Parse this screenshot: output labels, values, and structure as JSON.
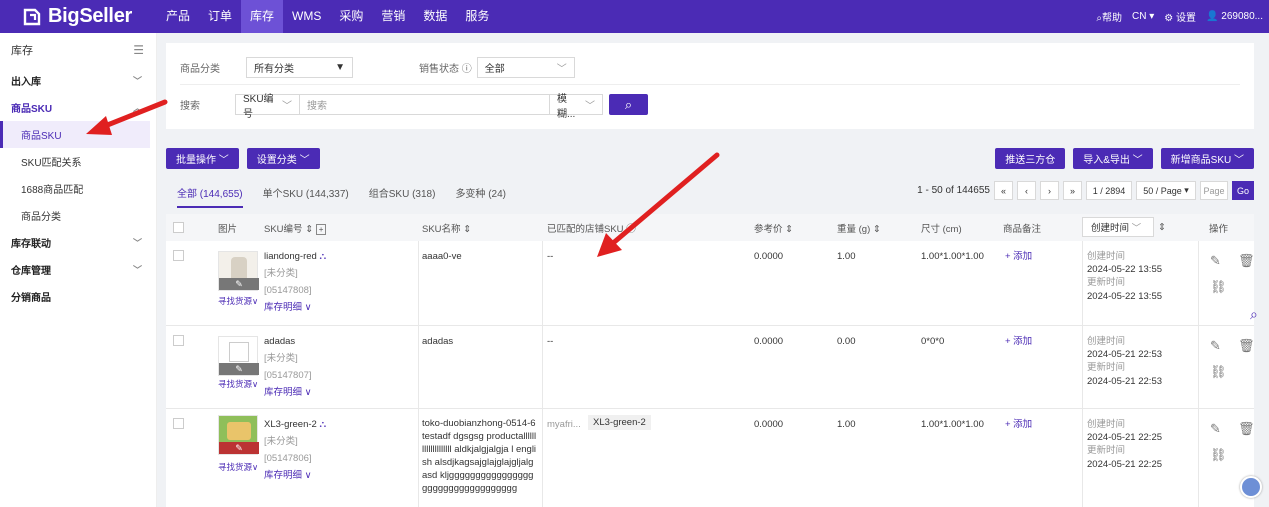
{
  "brand": {
    "name": "BigSeller"
  },
  "nav": {
    "items": [
      "产品",
      "订单",
      "库存",
      "WMS",
      "采购",
      "营销",
      "数据",
      "服务"
    ],
    "active": "库存"
  },
  "topright": {
    "help": "帮助",
    "lang": "CN",
    "settings": "设置",
    "user": "269080..."
  },
  "sidebar": {
    "title": "库存",
    "groups": [
      {
        "label": "出入库"
      },
      {
        "label": "商品SKU",
        "items": [
          "商品SKU",
          "SKU匹配关系",
          "1688商品匹配",
          "商品分类"
        ]
      },
      {
        "label": "库存联动"
      },
      {
        "label": "仓库管理"
      },
      {
        "label": "分销商品"
      }
    ]
  },
  "filter": {
    "category_label": "商品分类",
    "category_value": "所有分类",
    "status_label": "销售状态",
    "status_value": "全部",
    "search_label": "搜索",
    "search_field": "SKU编号",
    "search_placeholder": "搜索",
    "match_mode": "模糊..."
  },
  "toolbar": {
    "batch": "批量操作",
    "set_category": "设置分类",
    "push": "推送三方仓",
    "import_export": "导入&导出",
    "add": "新增商品SKU"
  },
  "tabs": [
    {
      "label": "全部 (144,655)"
    },
    {
      "label": "单个SKU (144,337)"
    },
    {
      "label": "组合SKU (318)"
    },
    {
      "label": "多变种 (24)"
    }
  ],
  "pager": {
    "range": "1 - 50 of 144655",
    "page": "1 / 2894",
    "per_page": "50 / Page",
    "page_placeholder": "Page",
    "go": "Go"
  },
  "columns": {
    "image": "图片",
    "sku_code": "SKU编号",
    "sku_name": "SKU名称",
    "matched": "已匹配的店铺SKU",
    "price": "参考价",
    "weight": "重量 (g)",
    "size": "尺寸 (cm)",
    "note": "商品备注",
    "time": "创建时间",
    "ops": "操作"
  },
  "rows": [
    {
      "sku": "liandong-red",
      "category": "[未分类]",
      "id": "[05147808]",
      "source": "寻找货源",
      "stock": "库存明细",
      "name": "aaaa0-ve",
      "matched": "--",
      "store": "",
      "price": "0.0000",
      "weight": "1.00",
      "size": "1.00*1.00*1.00",
      "note": "+ 添加",
      "created_label": "创建时间",
      "created": "2024-05-22 13:55",
      "updated_label": "更新时间",
      "updated": "2024-05-22 13:55"
    },
    {
      "sku": "adadas",
      "category": "[未分类]",
      "id": "[05147807]",
      "source": "寻找货源",
      "stock": "库存明细",
      "name": "adadas",
      "matched": "--",
      "store": "",
      "price": "0.0000",
      "weight": "0.00",
      "size": "0*0*0",
      "note": "+ 添加",
      "created_label": "创建时间",
      "created": "2024-05-21 22:53",
      "updated_label": "更新时间",
      "updated": "2024-05-21 22:53"
    },
    {
      "sku": "XL3-green-2",
      "category": "[未分类]",
      "id": "[05147806]",
      "source": "寻找货源",
      "stock": "库存明细",
      "name": "toko-duobianzhong-0514-6testadf dgsgsg productallllllllllllllllllll aldkjalgjalgja l english alsdjkagsajglajglajgljalgasd kljgggggggggggggggg gggggggggggggggggg",
      "matched": "myafri...",
      "store": "XL3-green-2",
      "price": "0.0000",
      "weight": "1.00",
      "size": "1.00*1.00*1.00",
      "note": "+ 添加",
      "created_label": "创建时间",
      "created": "2024-05-21 22:25",
      "updated_label": "更新时间",
      "updated": "2024-05-21 22:25"
    }
  ],
  "colors": {
    "primary": "#4b2bb5",
    "annotation": "#e02020"
  }
}
